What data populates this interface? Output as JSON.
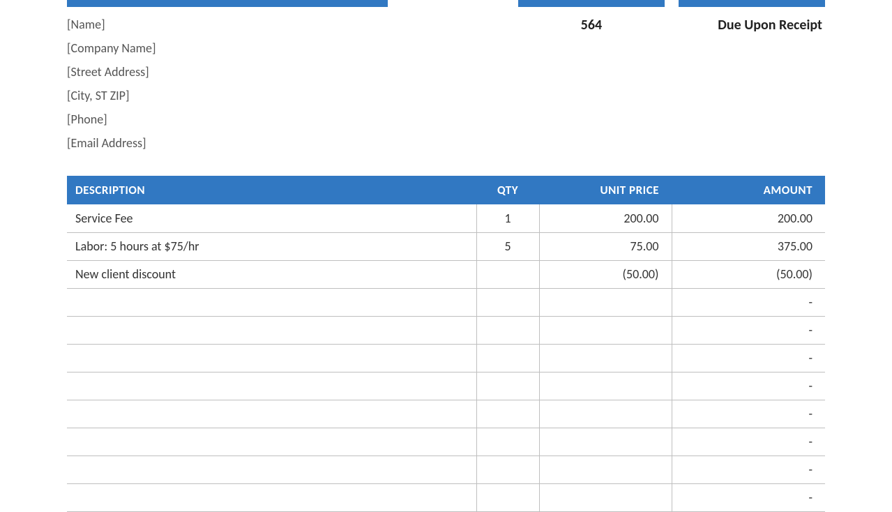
{
  "header": {
    "invoice_number": "564",
    "terms": "Due Upon Receipt"
  },
  "billto": {
    "name": "[Name]",
    "company": "[Company Name]",
    "street": "[Street Address]",
    "citystzip": "[City, ST  ZIP]",
    "phone": "[Phone]",
    "email": "[Email Address]"
  },
  "table": {
    "headers": {
      "description": "DESCRIPTION",
      "qty": "QTY",
      "unit_price": "UNIT PRICE",
      "amount": "AMOUNT"
    },
    "rows": [
      {
        "description": "Service Fee",
        "qty": "1",
        "unit_price": "200.00",
        "amount": "200.00"
      },
      {
        "description": "Labor: 5 hours at $75/hr",
        "qty": "5",
        "unit_price": "75.00",
        "amount": "375.00"
      },
      {
        "description": "New client discount",
        "qty": "",
        "unit_price": "(50.00)",
        "amount": "(50.00)"
      },
      {
        "description": "",
        "qty": "",
        "unit_price": "",
        "amount": "-"
      },
      {
        "description": "",
        "qty": "",
        "unit_price": "",
        "amount": "-"
      },
      {
        "description": "",
        "qty": "",
        "unit_price": "",
        "amount": "-"
      },
      {
        "description": "",
        "qty": "",
        "unit_price": "",
        "amount": "-"
      },
      {
        "description": "",
        "qty": "",
        "unit_price": "",
        "amount": "-"
      },
      {
        "description": "",
        "qty": "",
        "unit_price": "",
        "amount": "-"
      },
      {
        "description": "",
        "qty": "",
        "unit_price": "",
        "amount": "-"
      },
      {
        "description": "",
        "qty": "",
        "unit_price": "",
        "amount": "-"
      }
    ]
  }
}
